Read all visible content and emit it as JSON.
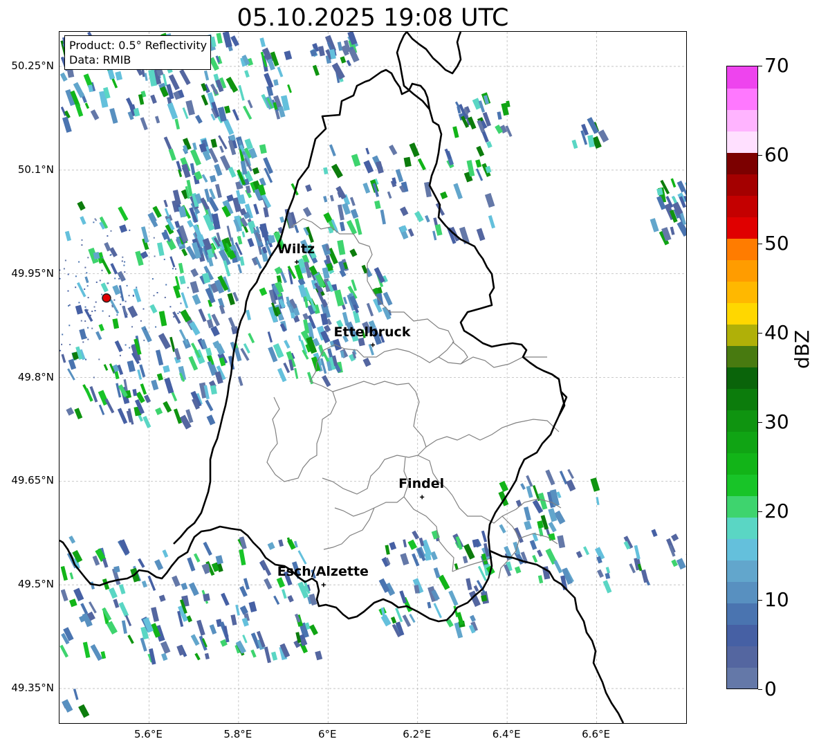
{
  "title": "05.10.2025 19:08 UTC",
  "info": {
    "product": "Product: 0.5° Reflectivity",
    "data_source": "Data: RMIB"
  },
  "lat_ticks": [
    "50.25°N",
    "50.1°N",
    "49.95°N",
    "49.8°N",
    "49.65°N",
    "49.5°N",
    "49.35°N"
  ],
  "lon_ticks": [
    "5.6°E",
    "5.8°E",
    "6°E",
    "6.2°E",
    "6.4°E",
    "6.6°E"
  ],
  "cities": [
    {
      "name": "Wiltz",
      "lon": 5.93,
      "lat": 49.967
    },
    {
      "name": "Ettelbruck",
      "lon": 6.1,
      "lat": 49.847
    },
    {
      "name": "Findel",
      "lon": 6.21,
      "lat": 49.627
    },
    {
      "name": "Esch/Alzette",
      "lon": 5.99,
      "lat": 49.5
    }
  ],
  "radar_site": {
    "lon": 5.505,
    "lat": 49.915,
    "color": "#e00000"
  },
  "colorbar": {
    "unit": "dBZ",
    "min": 0,
    "max": 70,
    "tick_labels": [
      "0",
      "10",
      "20",
      "30",
      "40",
      "50",
      "60",
      "70"
    ],
    "colors": [
      "#6478a8",
      "#5466a0",
      "#4660a4",
      "#4a74b0",
      "#5890c0",
      "#62a6cc",
      "#64c0dc",
      "#5ad6c4",
      "#3ed46e",
      "#18c428",
      "#12b418",
      "#10a414",
      "#0f9410",
      "#0c7c0c",
      "#0a640a",
      "#487a10",
      "#b0b008",
      "#ffd700",
      "#ffb800",
      "#ff9c00",
      "#ff7c00",
      "#e00000",
      "#c40000",
      "#a40000",
      "#7c0000",
      "#ffe0ff",
      "#ffb4ff",
      "#ff78ff",
      "#ee44ee"
    ]
  },
  "extent": {
    "lon_min": 5.4,
    "lon_max": 6.8,
    "lat_min": 49.3,
    "lat_max": 50.3
  },
  "boundary_colors": {
    "country": "#000000",
    "canton": "#808080",
    "grid": "#bbbbbb"
  }
}
